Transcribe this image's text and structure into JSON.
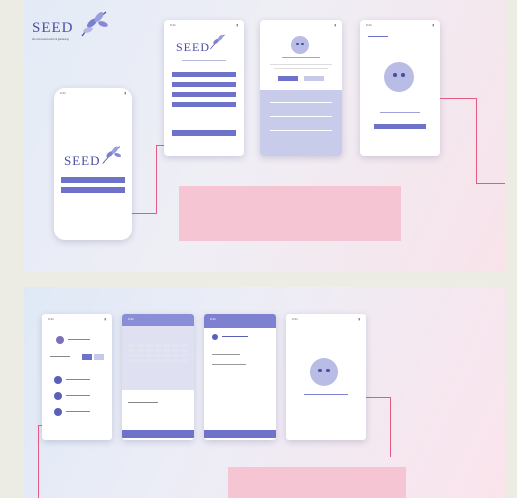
{
  "brand": {
    "logo_text": "SEED",
    "tagline": "the connected world of gardening"
  },
  "screens": {
    "splash": {
      "time": "9:41",
      "logo_text": "SEED",
      "buttons": [
        "",
        ""
      ]
    },
    "login": {
      "time": "9:41",
      "logo_text": "SEED",
      "fields": [
        "",
        "",
        "",
        ""
      ]
    },
    "empty": {
      "time": "9:41"
    },
    "plants": {
      "time": "9:41"
    },
    "calendar": {
      "time": "9:41"
    },
    "detail": {
      "time": "9:41"
    },
    "error": {
      "time": "9:41"
    }
  },
  "colors": {
    "accent": "#6e72c8",
    "light_accent": "#c6c9ea",
    "highlight": "#f6c5d4",
    "wire": "#e45c84"
  }
}
